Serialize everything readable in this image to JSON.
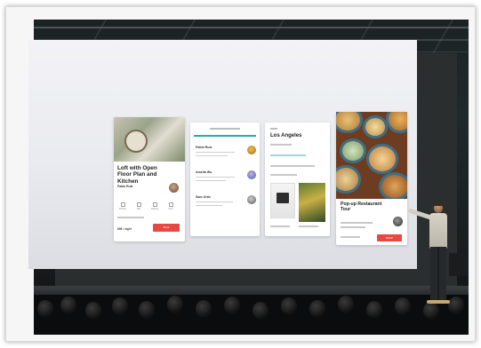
{
  "slides": {
    "listing_card": {
      "title": "Loft with Open Floor Plan and Kitchen",
      "host": "Pablo Ruiz",
      "amenities": [
        "Kitchen",
        "Wifi",
        "Parking",
        "Pool"
      ],
      "price": "$98 / night",
      "book_label": "Book"
    },
    "messages_card": {
      "rows": [
        {
          "name": "Pablo Ruiz"
        },
        {
          "name": "Amelia Wu"
        },
        {
          "name": "Sam Ortiz"
        }
      ]
    },
    "city_card": {
      "title": "Los Angeles"
    },
    "event_card": {
      "title": "Pop-up Restaurant Tour",
      "rsvp_label": "RSVP"
    }
  }
}
